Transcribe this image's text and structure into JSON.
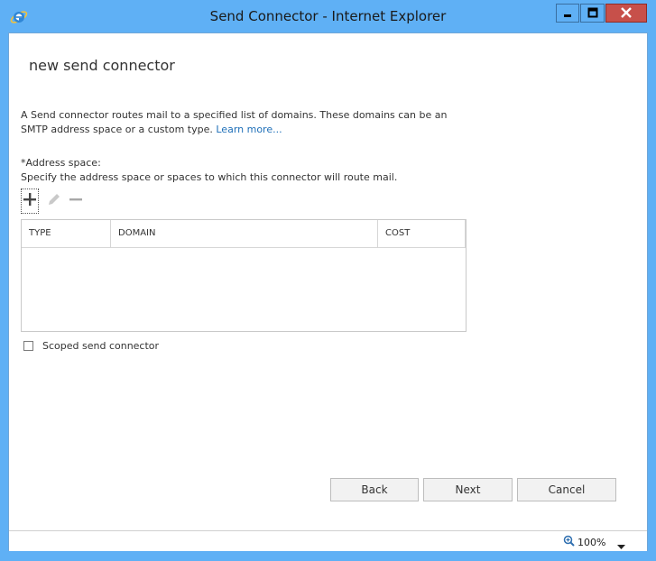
{
  "window": {
    "title": "Send Connector - Internet Explorer",
    "accent_color": "#5fb0f5",
    "close_color": "#c7504a"
  },
  "page": {
    "heading": "new send connector",
    "description": "A Send connector routes mail to a specified list of domains. These domains can be an SMTP address space or a custom type.",
    "learn_more": "Learn more...",
    "address_space_label": "*Address space:",
    "address_space_hint": "Specify the address space or spaces to which this connector will route mail."
  },
  "toolbar": {
    "add_icon": "plus-icon",
    "edit_icon": "pencil-icon",
    "remove_icon": "minus-icon"
  },
  "grid": {
    "columns": [
      "TYPE",
      "DOMAIN",
      "COST"
    ],
    "rows": []
  },
  "options": {
    "scoped_label": "Scoped send connector",
    "scoped_checked": false
  },
  "buttons": {
    "back": "Back",
    "next": "Next",
    "cancel": "Cancel"
  },
  "status": {
    "zoom": "100%"
  }
}
